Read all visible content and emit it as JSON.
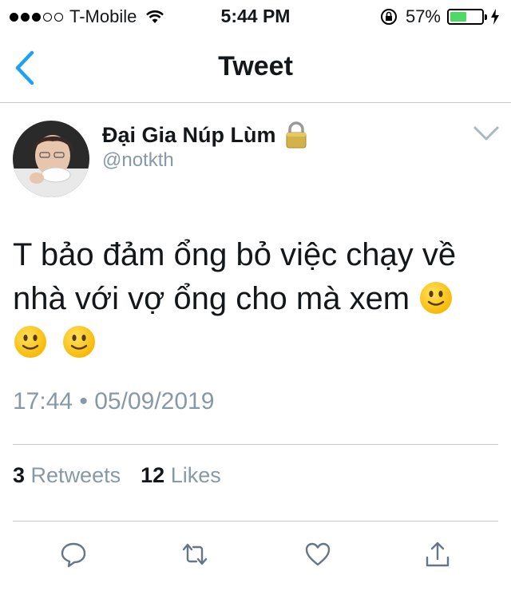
{
  "status_bar": {
    "carrier": "T-Mobile",
    "time": "5:44 PM",
    "battery_percent": "57%",
    "battery_level": 0.57,
    "signal_bars_filled": 3,
    "signal_bars_total": 5
  },
  "nav": {
    "title": "Tweet"
  },
  "tweet": {
    "author_name": "Đại Gia Núp Lùm",
    "handle": "@notkth",
    "text": "T bảo đảm ổng bỏ việc chạy về nhà với vợ ổng cho mà xem",
    "emoji_name": "slightly-smiling-face",
    "timestamp": "17:44 • 05/09/2019",
    "retweets_count": "3",
    "retweets_label": "Retweets",
    "likes_count": "12",
    "likes_label": "Likes"
  },
  "colors": {
    "accent": "#1da1f2",
    "secondary_text": "#8899a6",
    "battery_green": "#4cd964"
  }
}
